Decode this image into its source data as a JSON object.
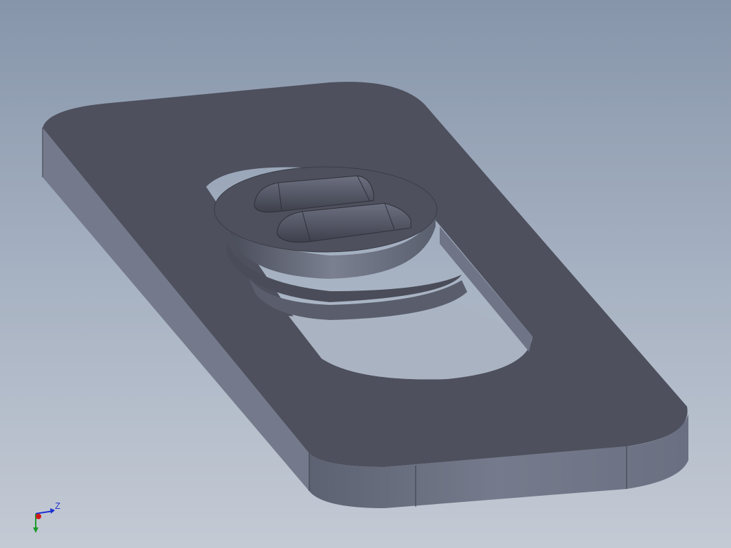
{
  "viewport": {
    "view": "isometric",
    "background_top": "#8795aa",
    "background_bottom": "#c4cad4"
  },
  "model": {
    "part": "slotted-plate",
    "top_face_color": "#4e505d",
    "side_face_color": "#6f7586",
    "features": [
      "rounded-rectangular-plate",
      "elongated-slot",
      "cylindrical-boss",
      "two-rounded-ribs"
    ]
  },
  "triad": {
    "z_label": "Z",
    "z_color": "#1a2fd0",
    "y_color": "#1a9a2a",
    "x_color": "#d01a1a"
  }
}
